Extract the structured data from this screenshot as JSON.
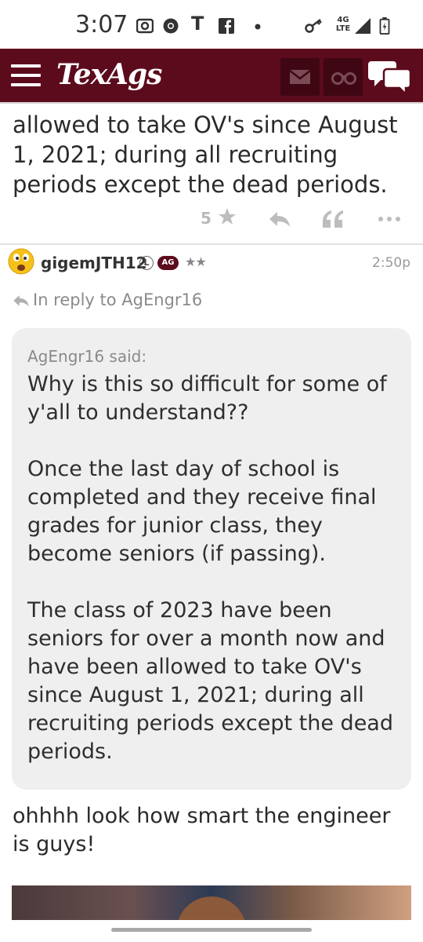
{
  "status_bar": {
    "time": "3:07",
    "network_top": "4G",
    "network_bottom": "LTE",
    "icons": [
      "camera-icon",
      "chrome-icon",
      "t-icon",
      "facebook-icon",
      "dot-icon",
      "key-icon",
      "signal-icon",
      "battery-icon"
    ]
  },
  "header": {
    "logo": "TexAgs",
    "brand_color": "#5c0b1d",
    "icons": [
      "menu-icon",
      "mail-icon",
      "binoculars-icon",
      "chat-icon"
    ]
  },
  "previous_post": {
    "text": "allowed to take OV's since August 1, 2021; during all recruiting periods except the dead periods.",
    "like_count": "5"
  },
  "post": {
    "username": "gigemJTH12",
    "badge_l": "L",
    "badge_ag": "AG",
    "stars": "★★",
    "time": "2:50p",
    "in_reply_to": "In reply to AgEngr16",
    "quote": {
      "author": "AgEngr16 said:",
      "text": "Why is this so difficult for some of y'all to understand??\n\nOnce the last day of school is completed and they receive final grades for junior class, they become seniors (if passing).\n\nThe class of 2023 have been seniors for over a month now and have been allowed to take OV's since August 1, 2021; during all recruiting periods except the dead periods."
    },
    "reply_text": "ohhhh look how smart the engineer is guys!"
  }
}
